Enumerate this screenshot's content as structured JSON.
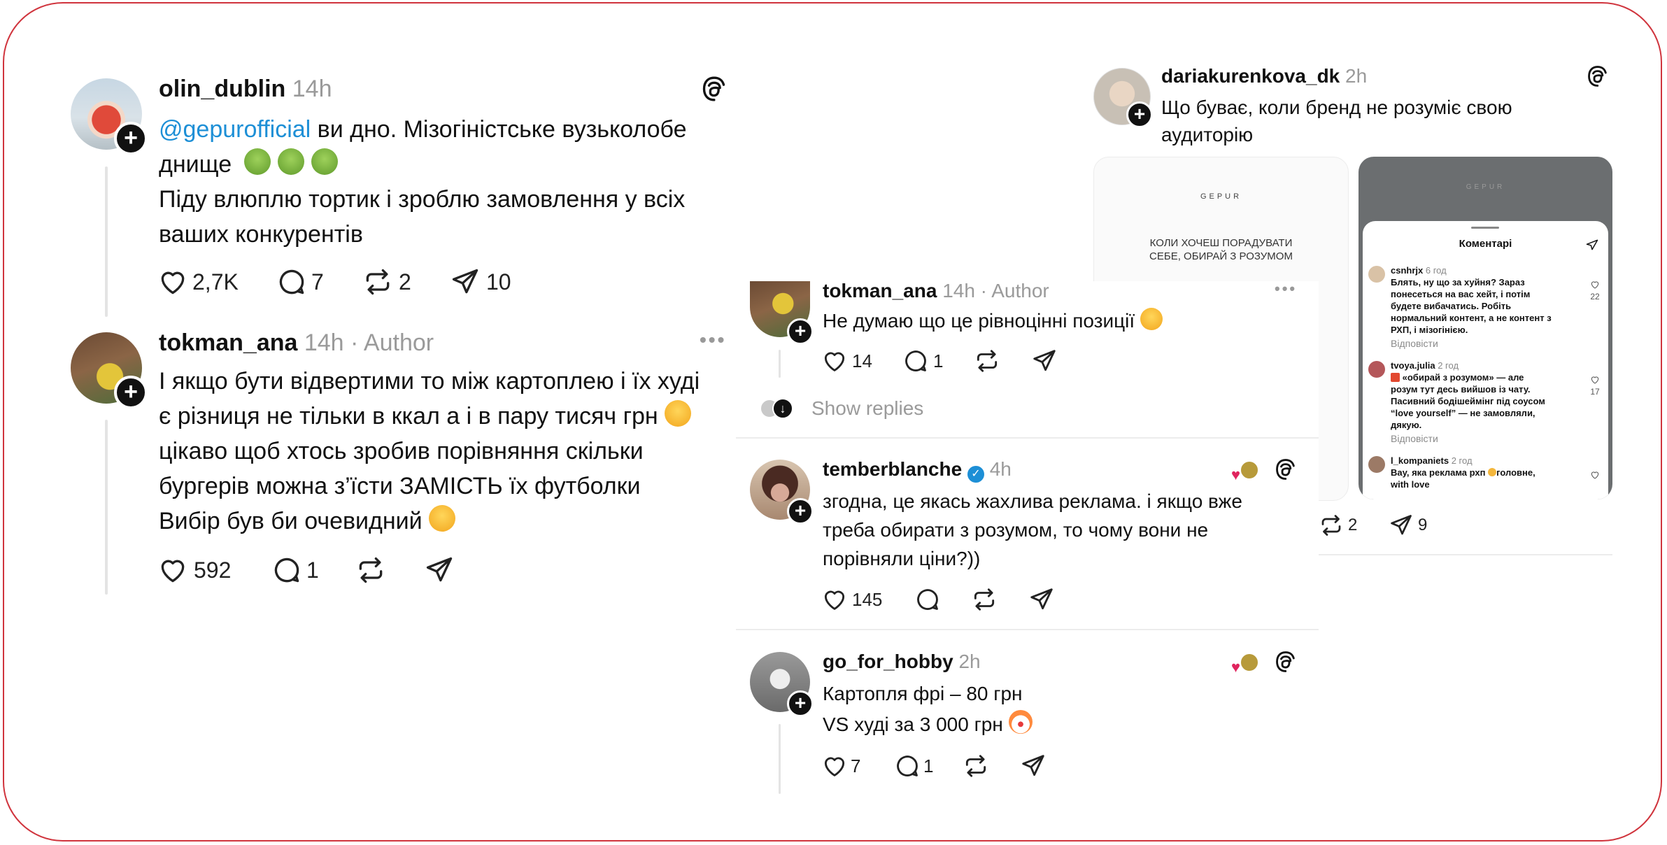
{
  "left_thread": {
    "post": {
      "username": "olin_dublin",
      "time": "14h",
      "mention": "@gepurofficial",
      "text_line1_rest": " ви дно. Мізогіністське вузьколобе",
      "text_line2": "днище",
      "text_line3": "Піду влюплю тортик і зроблю замовлення у всіх",
      "text_line4": "ваших конкурентів",
      "likes": "2,7K",
      "comments": "7",
      "reposts": "2",
      "shares": "10"
    },
    "reply": {
      "username": "tokman_ana",
      "time": "14h · Author",
      "lines": [
        "І якщо бути відвертими то між картоплею і їх худі",
        "є різниця не тільки в ккал а і в пару тисяч грн",
        "цікаво щоб хтось зробив порівняння скільки",
        "бургерів можна з’їсти ЗАМІСТЬ їх футболки",
        "Вибір був би очевидний"
      ],
      "likes": "592",
      "comments": "1"
    }
  },
  "right_post": {
    "username": "dariakurenkova_dk",
    "time": "2h",
    "text_line1": "Що буває, коли бренд не розуміє свою",
    "text_line2": "аудиторію",
    "reposts": "2",
    "shares": "9",
    "image1": {
      "brand": "GEPUR",
      "caption_line1": "КОЛИ ХОЧЕШ ПОРАДУВАТИ",
      "caption_line2": "СЕБЕ, ОБИРАЙ З РОЗУМОМ"
    },
    "image2": {
      "brand": "GEPUR",
      "sheet_title": "Коментарі",
      "comments": [
        {
          "user": "csnhrjx",
          "time": "6 год",
          "lines": [
            "Блять, ну що за хуйня? Зараз",
            "понесеться на вас хейт, і потім",
            "будете вибачатись. Робіть",
            "нормальний контент, а не контент з",
            "РХП, і мізогінією."
          ],
          "reply": "Відповісти",
          "likes": "22"
        },
        {
          "user": "tvoya.julia",
          "time": "2 год",
          "lines": [
            "«обирай з розумом» — але",
            "розум тут десь вийшов із чату.",
            "Пасивний бодішеймінг під соусом",
            "“love yourself” — не замовляли,",
            "дякую."
          ],
          "reply": "Відповісти",
          "likes": "17"
        },
        {
          "user": "l_kompaniets",
          "time": "2 год",
          "lines": [
            "Вау, яка реклама рхп",
            "головне,",
            "with love"
          ],
          "reply": "",
          "likes": ""
        }
      ]
    }
  },
  "middle_thread": {
    "reply1": {
      "username": "tokman_ana",
      "time": "14h · Author",
      "text": "Не думаю що це рівноцінні позиції",
      "likes": "14",
      "comments": "1"
    },
    "show_replies": "Show replies",
    "reply2": {
      "username": "temberblanche",
      "time": "4h",
      "lines": [
        "згодна, це якась жахлива реклама. і якщо вже",
        "треба обирати з розумом, то чому вони не",
        "порівняли ціни?))"
      ],
      "likes": "145"
    },
    "reply3": {
      "username": "go_for_hobby",
      "time": "2h",
      "line1": "Картопля фрі – 80 грн",
      "line2": "VS худі за 3 000 грн",
      "likes": "7",
      "comments": "1"
    }
  },
  "colors": {
    "frame_border": "#d0343d",
    "mention": "#1d8fd6",
    "verified": "#1d8fd6",
    "meta": "#9a9a9a"
  },
  "icons": [
    "threads-logo-icon",
    "heart-icon",
    "comment-icon",
    "repost-icon",
    "share-icon",
    "more-icon",
    "verified-icon",
    "follow-plus-icon",
    "nauseated-emoji",
    "grin-emoji",
    "relieved-emoji",
    "clown-emoji"
  ]
}
